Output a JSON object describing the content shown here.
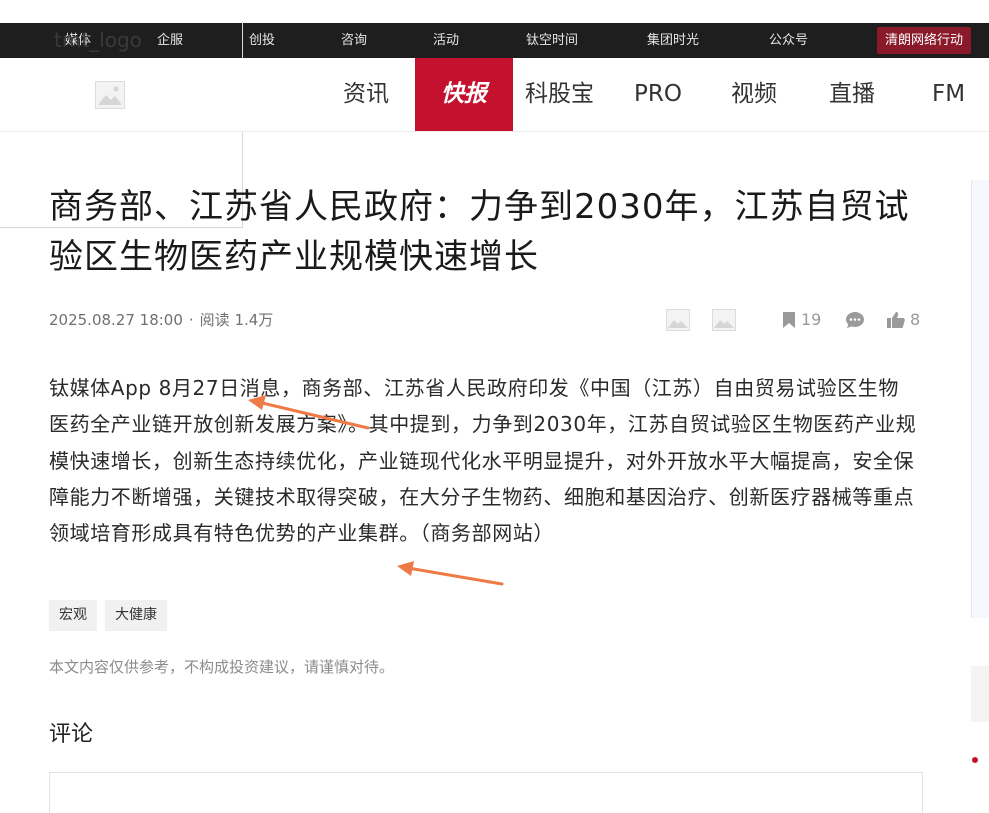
{
  "topbar": {
    "logo_text": "tmt_logo",
    "items": [
      "媒体",
      "企服",
      "创投",
      "咨询",
      "活动",
      "钛空时间",
      "集团时光",
      "公众号"
    ],
    "accent_item": "清朗网络行动"
  },
  "navbar": {
    "items": [
      "资讯",
      "快报",
      "科股宝",
      "PRO",
      "视频",
      "直播",
      "FM"
    ],
    "active": "快报"
  },
  "article": {
    "title": "商务部、江苏省人民政府：力争到2030年，江苏自贸试验区生物医药产业规模快速增长",
    "date": "2025.08.27 18:00",
    "separator": "·",
    "reads": "阅读 1.4万",
    "bookmarks": "19",
    "likes": "8",
    "body": "钛媒体App 8月27日消息，商务部、江苏省人民政府印发《中国（江苏）自由贸易试验区生物医药全产业链开放创新发展方案》。其中提到，力争到2030年，江苏自贸试验区生物医药产业规模快速增长，创新生态持续优化，产业链现代化水平明显提升，对外开放水平大幅提高，安全保障能力不断增强，关键技术取得突破，在大分子生物药、细胞和基因治疗、创新医疗器械等重点领域培育形成具有特色优势的产业集群。（商务部网站）",
    "tags": [
      "宏观",
      "大健康"
    ],
    "disclaimer": "本文内容仅供参考，不构成投资建议，请谨慎对待。"
  },
  "comments": {
    "title": "评论"
  },
  "colors": {
    "brand_red": "#c3112e",
    "topbar_bg": "#1e1e1e",
    "annotation_arrow": "#f07a45"
  },
  "icons": [
    "image-placeholder-icon",
    "bookmark-icon",
    "comment-icon",
    "like-icon"
  ]
}
